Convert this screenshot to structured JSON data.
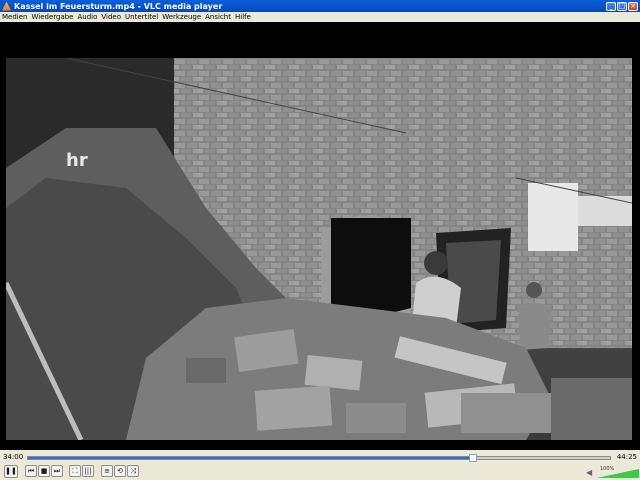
{
  "window": {
    "title": "Kassel im Feuersturm.mp4 - VLC media player",
    "minimize_icon": "minimize-icon",
    "maximize_icon": "maximize-icon",
    "close_icon": "close-icon"
  },
  "menu": {
    "items": [
      "Medien",
      "Wiedergabe",
      "Audio",
      "Video",
      "Untertitel",
      "Werkzeuge",
      "Ansicht",
      "Hilfe"
    ]
  },
  "video": {
    "channel_logo": "hr"
  },
  "controls": {
    "time_elapsed": "34:00",
    "time_total": "44:25",
    "progress_fraction": 0.765,
    "volume_label": "100%",
    "volume_fraction": 1.0,
    "accent_color": "#2f6bd8",
    "volume_color": "#3cc84a",
    "buttons": [
      {
        "name": "pause-button",
        "icon": "pause-icon",
        "glyph": "❚❚"
      },
      {
        "name": "previous-button",
        "icon": "skip-back-icon",
        "glyph": "⏮"
      },
      {
        "name": "stop-button",
        "icon": "stop-icon",
        "glyph": "■"
      },
      {
        "name": "next-button",
        "icon": "skip-forward-icon",
        "glyph": "⏭"
      },
      {
        "name": "fullscreen-button",
        "icon": "fullscreen-icon",
        "glyph": "⛶"
      },
      {
        "name": "extended-settings-button",
        "icon": "equalizer-icon",
        "glyph": "|||"
      },
      {
        "name": "playlist-button",
        "icon": "playlist-icon",
        "glyph": "≡"
      },
      {
        "name": "loop-button",
        "icon": "loop-icon",
        "glyph": "⟲"
      },
      {
        "name": "shuffle-button",
        "icon": "shuffle-icon",
        "glyph": "⤨"
      }
    ]
  }
}
